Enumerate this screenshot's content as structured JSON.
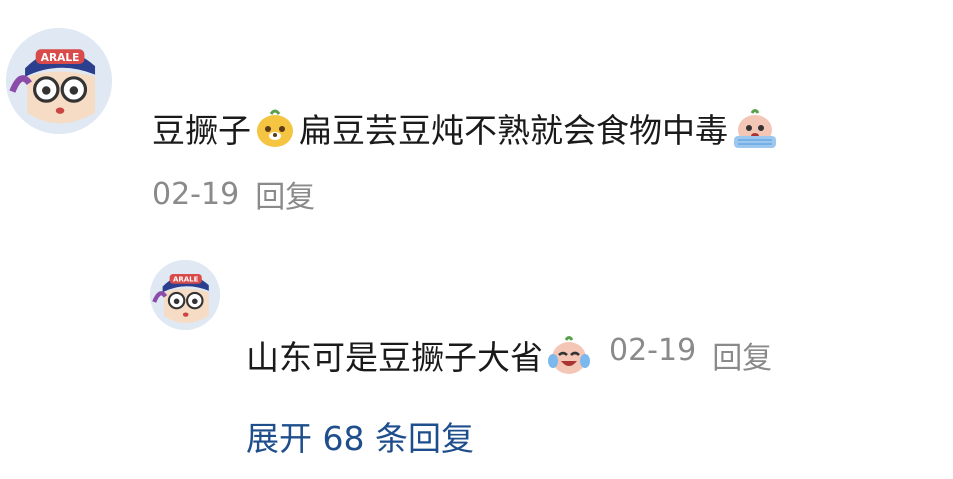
{
  "comment": {
    "text_before_emoji": "豆撅子",
    "emoji_1": "yellow-dog-emoji",
    "text_middle": "扁豆芸豆炖不熟就会食物中毒",
    "emoji_2": "crying-face-emoji",
    "date": "02-19",
    "reply_label": "回复"
  },
  "reply": {
    "text": "山东可是豆撅子大省",
    "emoji": "laugh-cry-face-emoji",
    "date": "02-19",
    "reply_label": "回复"
  },
  "expand": {
    "label": "展开 68 条回复"
  },
  "colors": {
    "text": "#1a1a1a",
    "meta": "#8a8a8a",
    "link": "#1f4e8c"
  }
}
